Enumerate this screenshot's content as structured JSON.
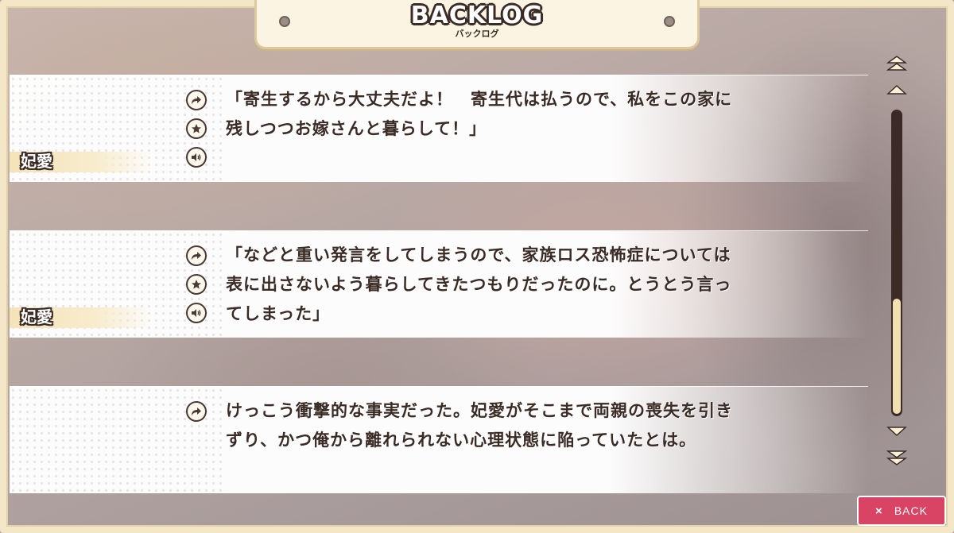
{
  "header": {
    "title": "BACKLOG",
    "subtitle": "バックログ"
  },
  "entries": [
    {
      "speaker": "妃愛",
      "text": "「寄生するから大丈夫だよ！　寄生代は払うので、私をこの家に残しつつお嫁さんと暮らして！」"
    },
    {
      "speaker": "妃愛",
      "text": "「などと重い発言をしてしまうので、家族ロス恐怖症については表に出さないよう暮らしてきたつもりだったのに。とうとう言ってしまった」"
    },
    {
      "speaker": "",
      "text": "けっこう衝撃的な事実だった。妃愛がそこまで両親の喪失を引きずり、かつ俺から離れられない心理状態に陥っていたとは。"
    }
  ],
  "icons": {
    "jump": "jump-arrow-icon",
    "favorite": "star-icon",
    "voice": "speaker-icon"
  },
  "scroll": {
    "position": 0.75
  },
  "back_button": {
    "icon": "×",
    "label": "BACK"
  },
  "colors": {
    "accent": "#d94464",
    "frame": "#f3e7c7",
    "ink": "#3a2b25"
  }
}
